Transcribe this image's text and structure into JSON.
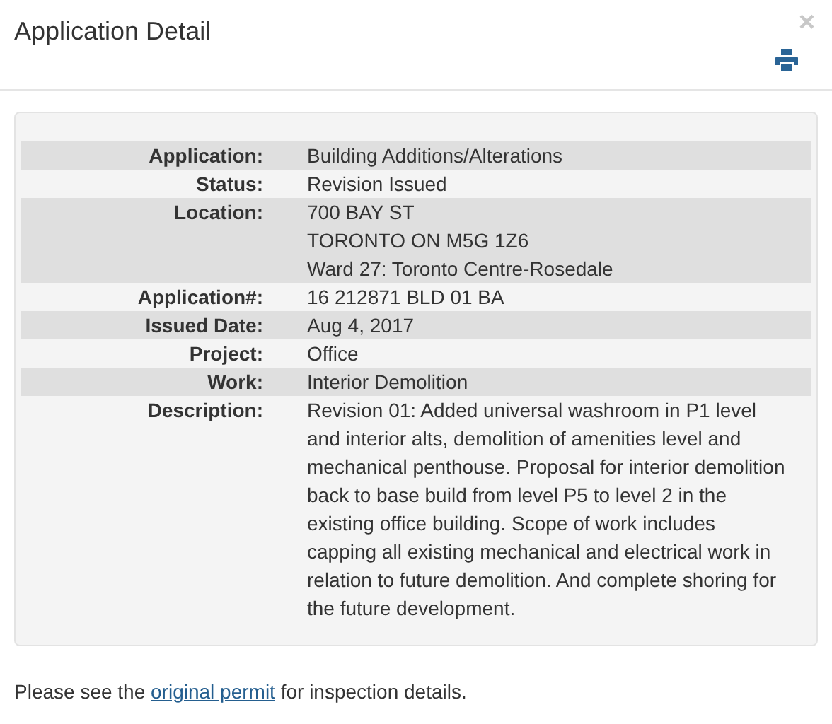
{
  "dialog": {
    "title": "Application Detail",
    "close": "×"
  },
  "details": [
    {
      "label": "Application:",
      "lines": [
        "Building Additions/Alterations"
      ]
    },
    {
      "label": "Status:",
      "lines": [
        "Revision Issued"
      ]
    },
    {
      "label": "Location:",
      "lines": [
        "700 BAY ST",
        "TORONTO ON M5G 1Z6",
        "Ward 27: Toronto Centre-Rosedale"
      ]
    },
    {
      "label": "Application#:",
      "lines": [
        "16 212871 BLD 01 BA"
      ]
    },
    {
      "label": "Issued Date:",
      "lines": [
        "Aug 4, 2017"
      ]
    },
    {
      "label": "Project:",
      "lines": [
        "Office"
      ]
    },
    {
      "label": "Work:",
      "lines": [
        "Interior Demolition"
      ]
    },
    {
      "label": "Description:",
      "lines": [
        "Revision 01: Added universal washroom in P1 level and interior alts, demolition of amenities level and mechanical penthouse. Proposal for interior demolition back to base build from level P5 to level 2 in the existing office building. Scope of work includes capping all existing mechanical and electrical work in relation to future demolition. And complete shoring for the future development."
      ]
    }
  ],
  "footer": {
    "before": "Please see the",
    "link": "original permit",
    "after": "for inspection details."
  }
}
